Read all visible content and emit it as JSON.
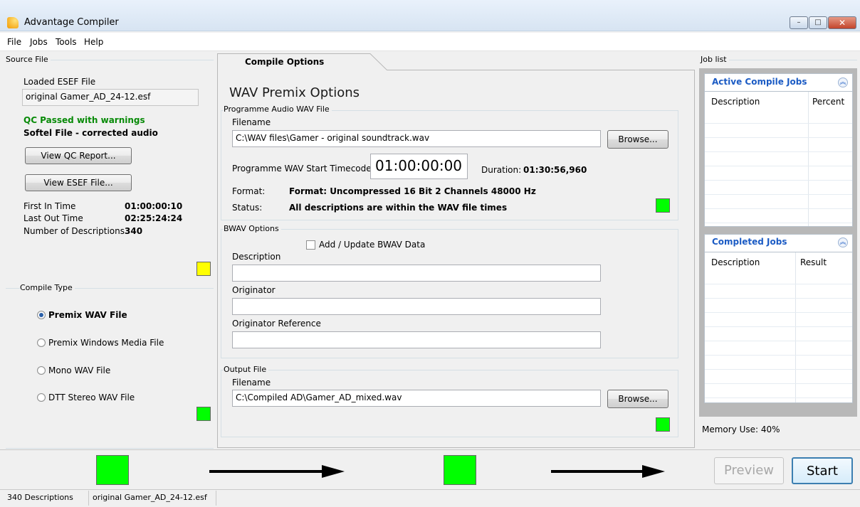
{
  "window": {
    "title": "Advantage Compiler",
    "min": "–",
    "max": "□",
    "close": "✕"
  },
  "menu": {
    "items": [
      "File",
      "Jobs",
      "Tools",
      "Help"
    ]
  },
  "source": {
    "group_label": "Source File",
    "loaded_label": "Loaded ESEF File",
    "loaded_value": "original Gamer_AD_24-12.esf",
    "qc_status": "QC Passed with warnings",
    "file_status": "Softel File - corrected audio",
    "view_qc_btn": "View QC Report...",
    "view_esef_btn": "View ESEF File...",
    "first_in_label": "First In Time",
    "first_in_value": "01:00:00:10",
    "last_out_label": "Last Out Time",
    "last_out_value": "02:25:24:24",
    "num_desc_label": "Number of Descriptions",
    "num_desc_value": "340",
    "indicator_color": "#ffff00"
  },
  "compile_type": {
    "group_label": "Compile Type",
    "options": [
      "Premix WAV File",
      "Premix Windows Media File",
      "Mono WAV File",
      "DTT Stereo WAV File"
    ],
    "selected": "Premix WAV File",
    "indicator_color": "#00ff00"
  },
  "tab": {
    "label": "Compile Options"
  },
  "wav": {
    "heading": "WAV Premix Options",
    "programme_group": "Programme Audio WAV File",
    "filename_label": "Filename",
    "filename_value": "C:\\WAV files\\Gamer - original soundtrack.wav",
    "browse_label": "Browse...",
    "start_tc_label": "Programme WAV Start Timecode",
    "start_tc_value": "01:00:00:00",
    "duration_label": "Duration:",
    "duration_value": "01:30:56,960",
    "format_label": "Format:",
    "format_value": "Format: Uncompressed 16 Bit 2 Channels 48000 Hz",
    "status_label": "Status:",
    "status_value": "All descriptions are within the WAV file times",
    "indicator_color": "#00ff00"
  },
  "bwav": {
    "group_label": "BWAV Options",
    "checkbox_label": "Add / Update BWAV Data",
    "checked": false,
    "description_label": "Description",
    "description_value": "",
    "originator_label": "Originator",
    "originator_value": "",
    "originator_ref_label": "Originator Reference",
    "originator_ref_value": ""
  },
  "output": {
    "group_label": "Output File",
    "filename_label": "Filename",
    "filename_value": "C:\\Compiled AD\\Gamer_AD_mixed.wav",
    "browse_label": "Browse...",
    "indicator_color": "#00ff00"
  },
  "job_list": {
    "group_label": "Job list",
    "active_title": "Active Compile Jobs",
    "active_columns": [
      "Description",
      "Percent"
    ],
    "completed_title": "Completed Jobs",
    "completed_columns": [
      "Description",
      "Result"
    ],
    "memory_use": "Memory Use: 40%"
  },
  "actions": {
    "preview_label": "Preview",
    "start_label": "Start"
  },
  "status_bar": {
    "descriptions": "340 Descriptions",
    "file": "original Gamer_AD_24-12.esf"
  }
}
